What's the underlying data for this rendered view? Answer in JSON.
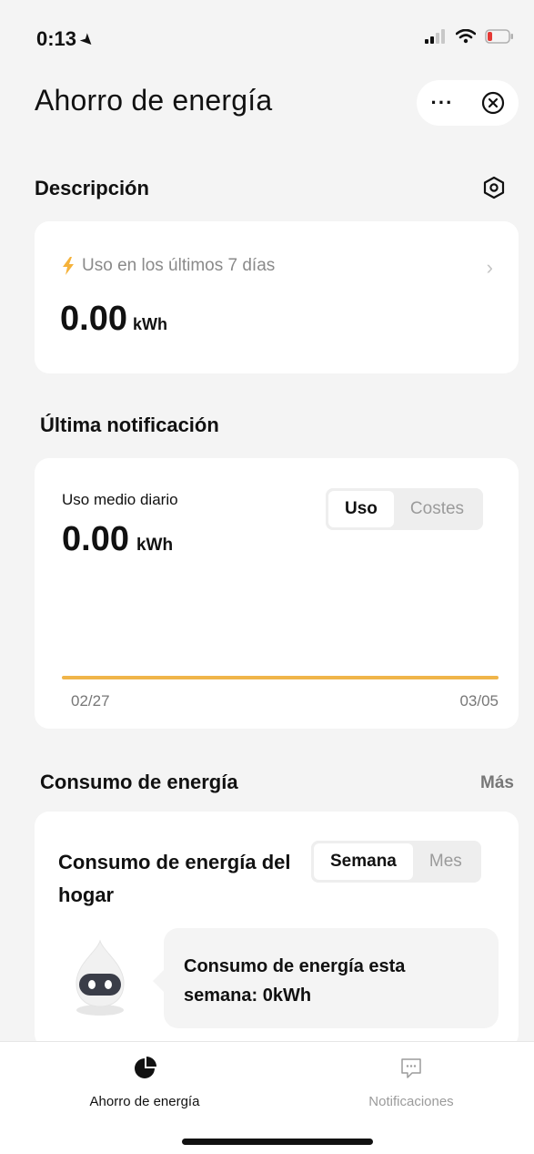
{
  "status_bar": {
    "time": "0:13"
  },
  "header": {
    "title": "Ahorro de energía",
    "more": "···"
  },
  "description": {
    "title": "Descripción",
    "usage_label": "Uso en los últimos 7 días",
    "value": "0.00",
    "unit": "kWh"
  },
  "last_notification": {
    "title": "Última notificación",
    "avg_label": "Uso medio diario",
    "value": "0.00",
    "unit": "kWh",
    "toggle": {
      "option1": "Uso",
      "option2": "Costes",
      "selected": "Uso"
    },
    "chart_dates": {
      "start": "02/27",
      "end": "03/05"
    }
  },
  "consumption": {
    "title": "Consumo de energía",
    "more": "Más",
    "card_title": "Consumo de energía del hogar",
    "toggle": {
      "option1": "Semana",
      "option2": "Mes",
      "selected": "Semana"
    },
    "message": "Consumo de energía esta semana: 0kWh"
  },
  "tabbar": {
    "tab1": "Ahorro de energía",
    "tab2": "Notificaciones"
  },
  "colors": {
    "accent": "#f0b54a",
    "background": "#f4f4f4",
    "card": "#ffffff"
  }
}
